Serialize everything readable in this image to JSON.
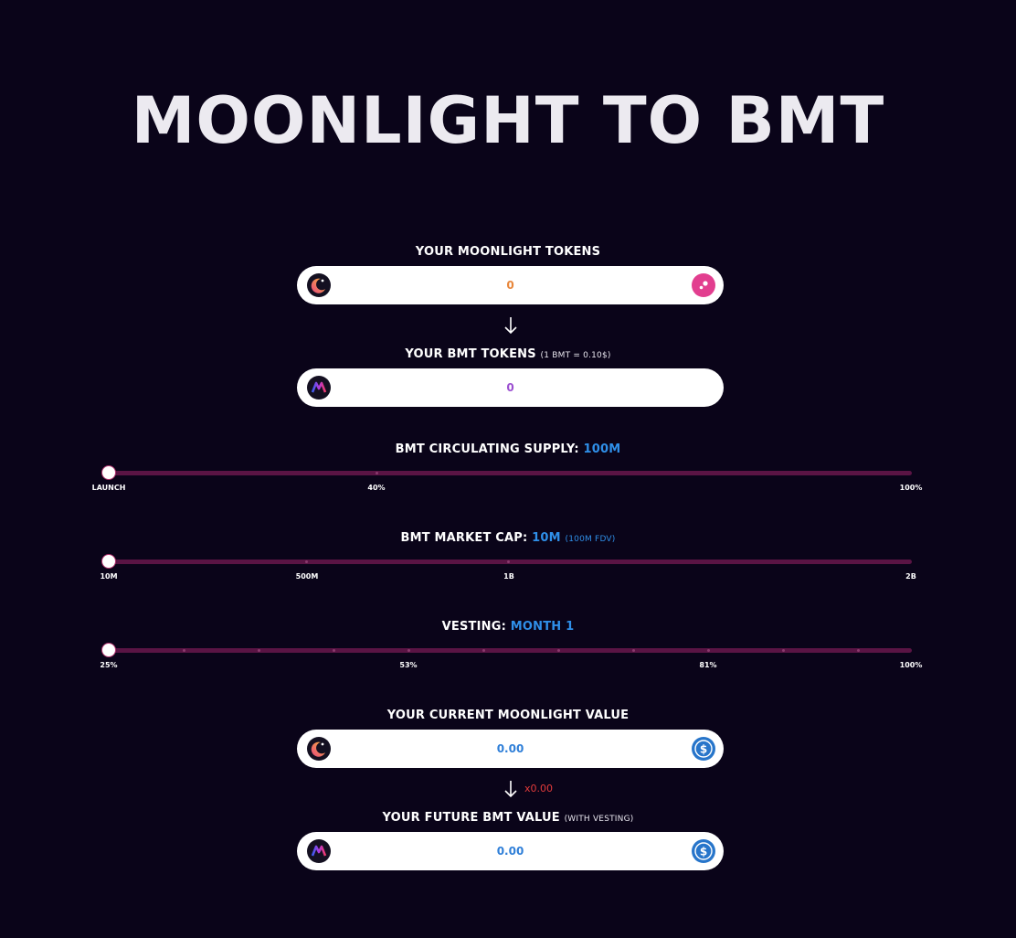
{
  "title": "MOONLIGHT TO BMT",
  "moonlight_tokens": {
    "label": "YOUR MOONLIGHT TOKENS",
    "value": "0",
    "value_color": "#e8863a",
    "left_icon": "moonlight-coin-icon",
    "right_icon": "pink-token-icon"
  },
  "bmt_tokens": {
    "label": "YOUR BMT TOKENS",
    "note": "(1 BMT = 0.10$)",
    "value": "0",
    "value_color": "#9b4fd0",
    "left_icon": "bmt-coin-icon"
  },
  "circulating_supply": {
    "label": "BMT CIRCULATING SUPPLY:",
    "value": "100M",
    "ticks": [
      "LAUNCH",
      "40%",
      "100%"
    ],
    "level": 0
  },
  "market_cap": {
    "label": "BMT MARKET CAP:",
    "value": "10M",
    "note": "(100M FDV)",
    "ticks": [
      "10M",
      "500M",
      "1B",
      "2B"
    ],
    "level": 0
  },
  "vesting": {
    "label": "VESTING:",
    "value": "MONTH 1",
    "ticks": [
      "25%",
      "53%",
      "81%",
      "100%"
    ],
    "level": 0
  },
  "current_value": {
    "label": "YOUR CURRENT MOONLIGHT VALUE",
    "value": "0.00",
    "value_color": "#2f7fd8",
    "left_icon": "moonlight-coin-icon",
    "right_icon": "usdc-icon"
  },
  "multiplier": "x0.00",
  "future_value": {
    "label": "YOUR FUTURE BMT VALUE",
    "note": "(WITH VESTING)",
    "value": "0.00",
    "value_color": "#2f7fd8",
    "left_icon": "bmt-coin-icon",
    "right_icon": "usdc-icon"
  },
  "colors": {
    "background": "#0a0419",
    "accent": "#2f8fe8",
    "slider_track": "#5a1444",
    "multiplier": "#e33b3b"
  }
}
